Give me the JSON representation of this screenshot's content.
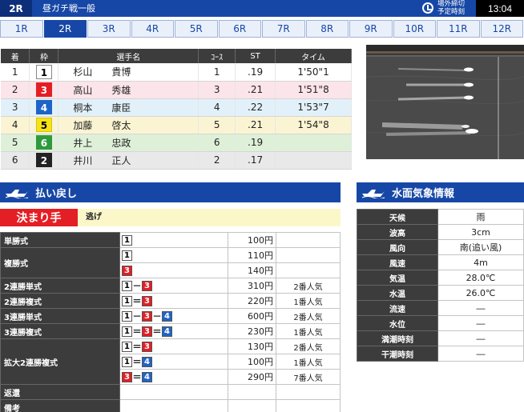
{
  "topbar": {
    "race": "2R",
    "race_name": "昼ガチ戦一般",
    "deadline_line1": "場外締切",
    "deadline_line2": "予定時刻",
    "time": "13:04"
  },
  "tabs": [
    "1R",
    "2R",
    "3R",
    "4R",
    "5R",
    "6R",
    "7R",
    "8R",
    "9R",
    "10R",
    "11R",
    "12R"
  ],
  "active_tab": "2R",
  "results": {
    "headers": [
      "着",
      "枠",
      "選手名",
      "ｺｰｽ",
      "ST",
      "タイム"
    ],
    "rows": [
      {
        "rank": "1",
        "waku": "1",
        "name": "杉山　　貴博",
        "course": "1",
        "st": ".19",
        "time": "1'50\"1"
      },
      {
        "rank": "2",
        "waku": "3",
        "name": "高山　　秀雄",
        "course": "3",
        "st": ".21",
        "time": "1'51\"8"
      },
      {
        "rank": "3",
        "waku": "4",
        "name": "桐本　　康臣",
        "course": "4",
        "st": ".22",
        "time": "1'53\"7"
      },
      {
        "rank": "4",
        "waku": "5",
        "name": "加藤　　啓太",
        "course": "5",
        "st": ".21",
        "time": "1'54\"8"
      },
      {
        "rank": "5",
        "waku": "6",
        "name": "井上　　忠政",
        "course": "6",
        "st": ".19",
        "time": ""
      },
      {
        "rank": "6",
        "waku": "2",
        "name": "井川　　正人",
        "course": "2",
        "st": ".17",
        "time": ""
      }
    ]
  },
  "sections": {
    "payout_title": "払い戻し",
    "weather_title": "水面気象情報"
  },
  "kimarite": {
    "label": "決まり手",
    "value": "逃げ"
  },
  "payout_rows": [
    {
      "kind": "単勝式",
      "combo": [
        "1"
      ],
      "seps": [],
      "yen": "100円",
      "pop": ""
    },
    {
      "kind": "複勝式",
      "combo": [
        "1"
      ],
      "seps": [],
      "yen": "110円",
      "pop": ""
    },
    {
      "kind": "",
      "combo": [
        "3"
      ],
      "seps": [],
      "yen": "140円",
      "pop": ""
    },
    {
      "kind": "2連勝単式",
      "combo": [
        "1",
        "3"
      ],
      "seps": [
        "－"
      ],
      "yen": "310円",
      "pop": "2番人気"
    },
    {
      "kind": "2連勝複式",
      "combo": [
        "1",
        "3"
      ],
      "seps": [
        "＝"
      ],
      "yen": "220円",
      "pop": "1番人気"
    },
    {
      "kind": "3連勝単式",
      "combo": [
        "1",
        "3",
        "4"
      ],
      "seps": [
        "－",
        "－"
      ],
      "yen": "600円",
      "pop": "2番人気"
    },
    {
      "kind": "3連勝複式",
      "combo": [
        "1",
        "3",
        "4"
      ],
      "seps": [
        "＝",
        "＝"
      ],
      "yen": "230円",
      "pop": "1番人気"
    },
    {
      "kind": "拡大2連勝複式",
      "combo": [
        "1",
        "3"
      ],
      "seps": [
        "＝"
      ],
      "yen": "130円",
      "pop": "2番人気"
    },
    {
      "kind": "",
      "combo": [
        "1",
        "4"
      ],
      "seps": [
        "＝"
      ],
      "yen": "100円",
      "pop": "1番人気"
    },
    {
      "kind": "",
      "combo": [
        "3",
        "4"
      ],
      "seps": [
        "＝"
      ],
      "yen": "290円",
      "pop": "7番人気"
    },
    {
      "kind": "返還",
      "combo": [],
      "seps": [],
      "yen": "",
      "pop": ""
    },
    {
      "kind": "備考",
      "combo": [],
      "seps": [],
      "yen": "",
      "pop": ""
    }
  ],
  "weather": [
    {
      "k": "天候",
      "v": "雨"
    },
    {
      "k": "波高",
      "v": "3cm"
    },
    {
      "k": "風向",
      "v": "南(追い風)"
    },
    {
      "k": "風速",
      "v": "4m"
    },
    {
      "k": "気温",
      "v": "28.0℃"
    },
    {
      "k": "水温",
      "v": "26.0℃"
    },
    {
      "k": "流速",
      "v": "―"
    },
    {
      "k": "水位",
      "v": "―"
    },
    {
      "k": "満潮時刻",
      "v": "―"
    },
    {
      "k": "干潮時刻",
      "v": "―"
    }
  ],
  "colors": {
    "header_blue": "#1747a6",
    "waku_1": "#ffffff",
    "waku_2": "#222222",
    "waku_3": "#e31e24",
    "waku_4": "#1e64c8",
    "waku_5": "#f5e219",
    "waku_6": "#2f9a3d"
  }
}
